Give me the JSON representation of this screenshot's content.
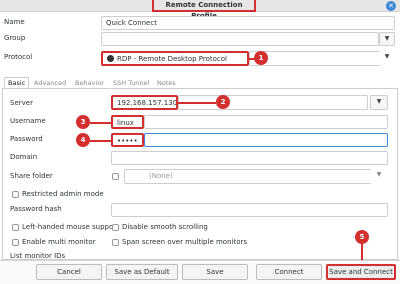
{
  "window": {
    "title": "Remote Connection Profile",
    "close_glyph": "✕"
  },
  "form": {
    "name_label": "Name",
    "name_value": "Quick Connect",
    "group_label": "Group",
    "group_value": "",
    "protocol_label": "Protocol",
    "protocol_value": "RDP - Remote Desktop Protocol"
  },
  "tabs": [
    "Basic",
    "Advanced",
    "Behavior",
    "SSH Tunnel",
    "Notes"
  ],
  "basic": {
    "server_label": "Server",
    "server_value": "192.168.157.130",
    "username_label": "Username",
    "username_value": "linux",
    "password_label": "Password",
    "password_value": "•••••",
    "domain_label": "Domain",
    "domain_value": "",
    "share_folder_label": "Share folder",
    "share_folder_value": "(None)",
    "restricted_admin_label": "Restricted admin mode",
    "password_hash_label": "Password hash",
    "left_handed_label": "Left-handed mouse support",
    "disable_smooth_label": "Disable smooth scrolling",
    "multi_monitor_label": "Enable multi monitor",
    "span_screen_label": "Span screen over multiple monitors",
    "list_monitor_label": "List monitor IDs"
  },
  "buttons": {
    "cancel": "Cancel",
    "save_default": "Save as Default",
    "save": "Save",
    "connect": "Connect",
    "save_connect": "Save and Connect"
  },
  "callouts": [
    "1",
    "2",
    "3",
    "4",
    "5"
  ],
  "icons": {
    "dropdown": "chevron-down-icon",
    "close": "close-icon"
  },
  "colors": {
    "annotation": "#d32f2f",
    "accent": "#3d87d8"
  }
}
